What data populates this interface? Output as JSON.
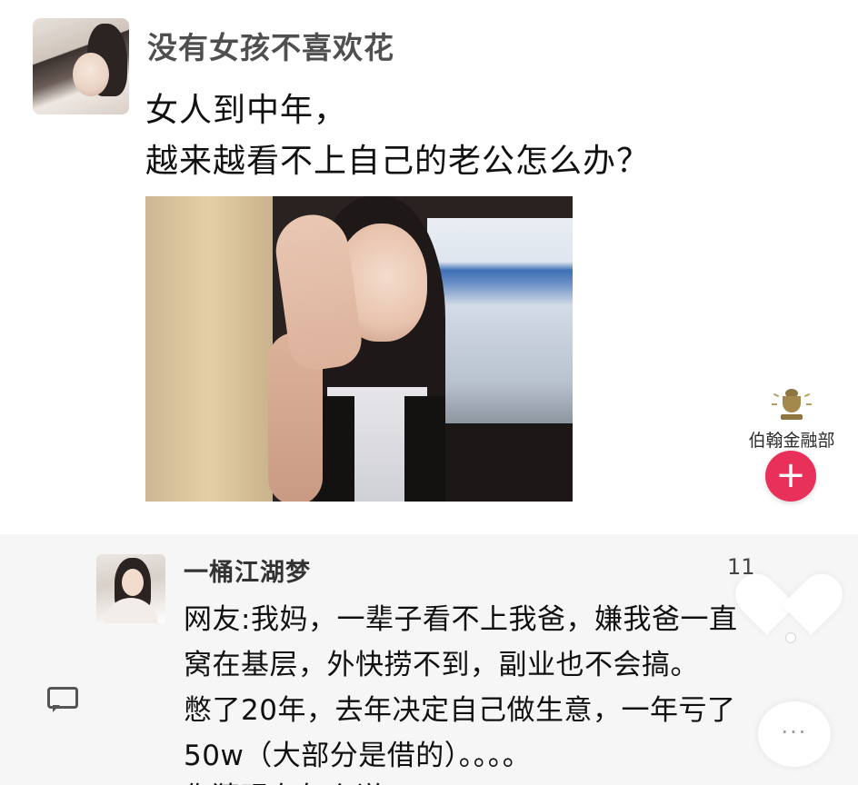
{
  "post": {
    "author": "没有女孩不喜欢花",
    "text_line1": "女人到中年，",
    "text_line2": "越来越看不上自己的老公怎么办？"
  },
  "watermark": {
    "name": "伯翰金融部",
    "icon": "gold-cup-logo-icon"
  },
  "actions": {
    "add_label": "+",
    "like_icon": "heart-icon",
    "more_label": "···",
    "comment_icon": "comment-bubble-icon"
  },
  "comment": {
    "author": "一桶江湖梦",
    "count_partial": "11",
    "lines": [
      "网友:我妈，一辈子看不上我爸，嫌我爸一直",
      "窝在基层，外快捞不到，副业也不会搞。",
      "憋了20年，去年决定自己做生意，一年亏了",
      "50w（大部分是借的）。。。。",
      "你猜现在怎么说？"
    ]
  },
  "colors": {
    "add_button": "#e8305a",
    "comment_panel_bg": "#f6f6f7",
    "author_text": "#4f4f4f"
  }
}
